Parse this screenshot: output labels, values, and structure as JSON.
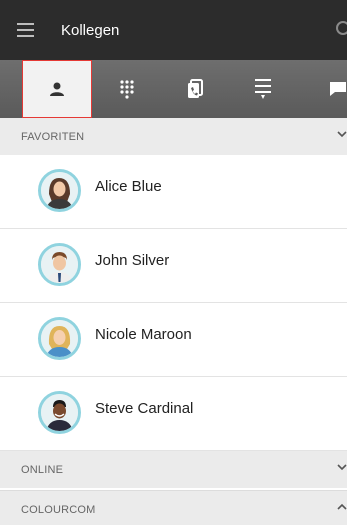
{
  "header": {
    "title": "Kollegen",
    "menu_icon": "hamburger-icon",
    "search_icon": "search-icon"
  },
  "tabs": [
    {
      "icon": "person-icon",
      "active": true
    },
    {
      "icon": "dialpad-icon",
      "active": false
    },
    {
      "icon": "call-transfer-icon",
      "active": false
    },
    {
      "icon": "call-list-icon",
      "active": false
    },
    {
      "icon": "chat-icon",
      "active": false
    }
  ],
  "sections": {
    "favorites": {
      "label": "FAVORITEN",
      "expanded": true
    },
    "online": {
      "label": "ONLINE",
      "expanded": false
    },
    "colourcom": {
      "label": "COLOURCOM",
      "expanded": true
    }
  },
  "contacts": [
    {
      "name": "Alice Blue"
    },
    {
      "name": "John Silver"
    },
    {
      "name": "Nicole Maroon"
    },
    {
      "name": "Steve Cardinal"
    }
  ],
  "colors": {
    "header": "#2c2c2c",
    "tabbar": "#666666",
    "active_border": "#e53935",
    "avatar_ring": "#8fd3df"
  }
}
